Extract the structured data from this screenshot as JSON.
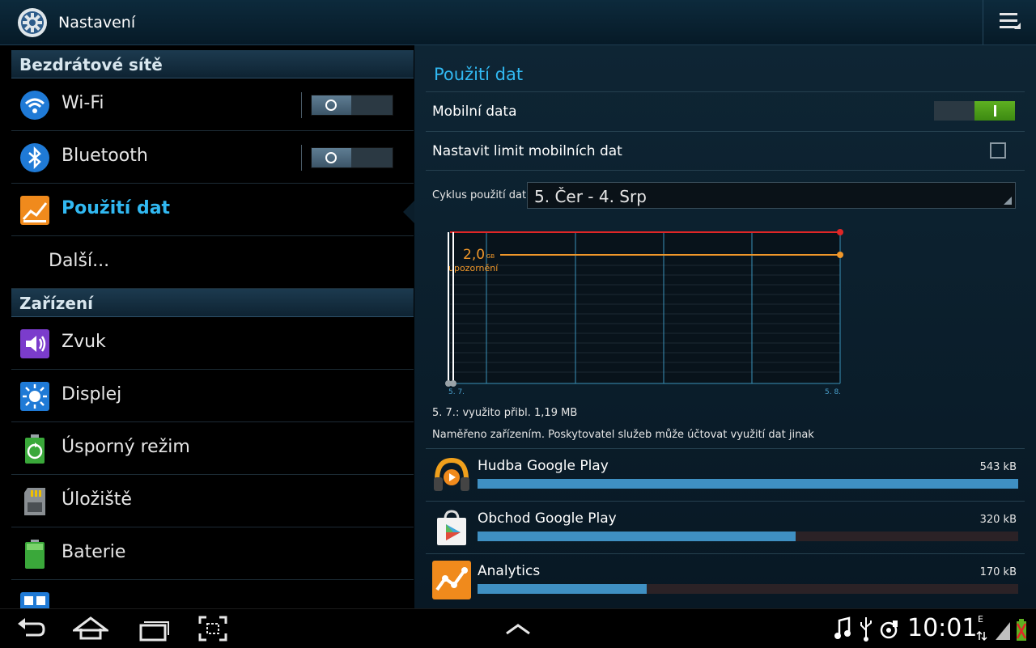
{
  "header": {
    "title": "Nastavení",
    "app_icon": "gear-icon",
    "menu_icon": "overflow-menu-icon"
  },
  "sidebar": {
    "sections": [
      {
        "label": "Bezdrátové sítě"
      },
      {
        "label": "Zařízení"
      }
    ],
    "items": [
      {
        "label": "Wi-Fi",
        "icon": "wifi-icon",
        "toggle": "off"
      },
      {
        "label": "Bluetooth",
        "icon": "bluetooth-icon",
        "toggle": "off"
      },
      {
        "label": "Použití dat",
        "icon": "data-usage-icon",
        "active": true
      },
      {
        "label": "Další..."
      },
      {
        "label": "Zvuk",
        "icon": "speaker-icon"
      },
      {
        "label": "Displej",
        "icon": "brightness-icon"
      },
      {
        "label": "Úsporný režim",
        "icon": "power-saving-icon"
      },
      {
        "label": "Úložiště",
        "icon": "sd-card-icon"
      },
      {
        "label": "Baterie",
        "icon": "battery-icon"
      }
    ]
  },
  "panel": {
    "title": "Použití dat",
    "mobile_data": {
      "label": "Mobilní data",
      "state": "on"
    },
    "limit": {
      "label": "Nastavit limit mobilních dat",
      "checked": false
    },
    "cycle": {
      "label": "Cyklus použití dat",
      "value": "5. Čer - 4. Srp"
    },
    "chart": {
      "warning_value": "2,0",
      "warning_unit": "GB",
      "warning_label": "upozornění",
      "x_start": "5. 7.",
      "x_end": "5. 8."
    },
    "usage_text": "5. 7.: využito přibl. 1,19 MB",
    "note": "Naměřeno zařízením. Poskytovatel služeb může účtovat využití dat jinak",
    "apps": [
      {
        "name": "Hudba Google Play",
        "size": "543 kB",
        "fraction": 1.0,
        "icon": "headphones-icon"
      },
      {
        "name": "Obchod Google Play",
        "size": "320 kB",
        "fraction": 0.589,
        "icon": "play-store-icon"
      },
      {
        "name": "Analytics",
        "size": "170 kB",
        "fraction": 0.313,
        "icon": "analytics-icon"
      }
    ]
  },
  "navbar": {
    "buttons": [
      "back-icon",
      "home-icon",
      "recent-apps-icon",
      "screenshot-icon",
      "up-arrow-icon"
    ],
    "status_icons": [
      "music-icon",
      "usb-icon",
      "sync-icon",
      "signal-icon",
      "battery-charging-icon"
    ],
    "network_letter": "E",
    "clock": "10:01"
  },
  "colors": {
    "accent": "#31b9f2",
    "warning": "#f0972a",
    "limit": "#e02626",
    "bar": "#3f90c3",
    "toggle_on": "#5eb021"
  }
}
